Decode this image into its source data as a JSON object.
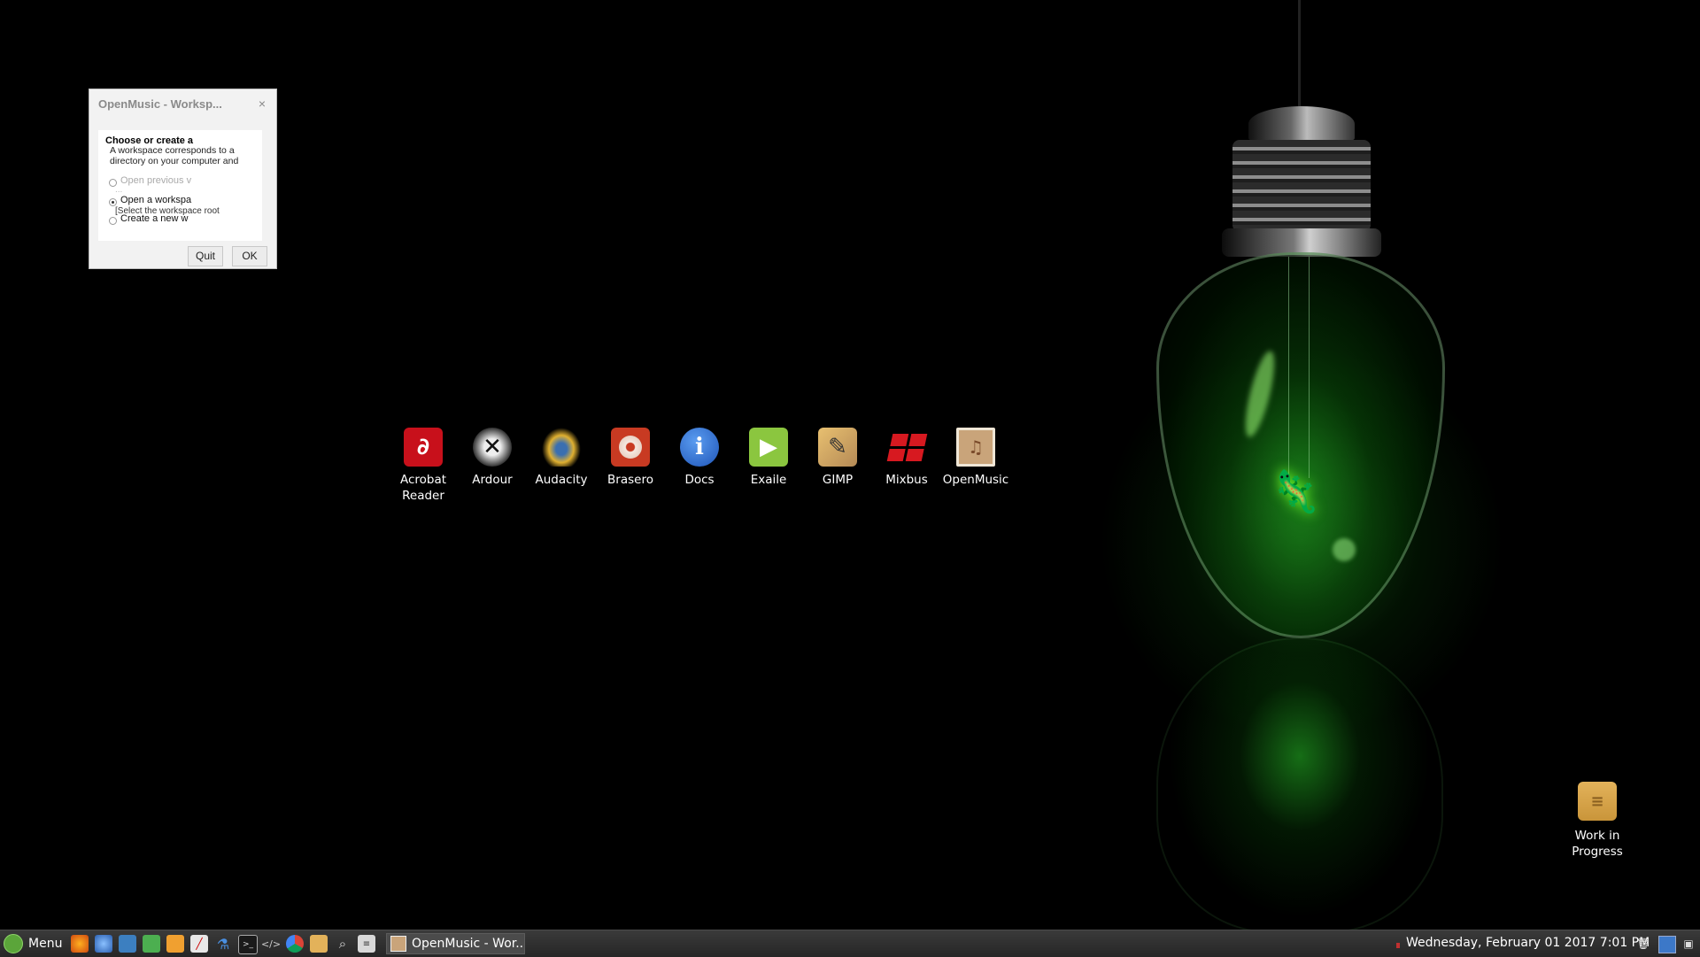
{
  "dialog": {
    "title": "OpenMusic - Worksp...",
    "close": "×",
    "heading": "Choose or create a",
    "description": "A workspace corresponds to a directory on your computer and",
    "option_previous": "Open previous v",
    "option_previous_sub": "...",
    "option_open": "Open a workspa",
    "option_open_sub": "[Select the workspace root",
    "option_create": "Create a new w",
    "quit_label": "Quit",
    "ok_label": "OK"
  },
  "desktop_icons": [
    {
      "name": "Acrobat Reader",
      "icon": "acrobat-icon",
      "color": "#c8101b"
    },
    {
      "name": "Ardour",
      "icon": "ardour-icon",
      "color": "#d0d0d0"
    },
    {
      "name": "Audacity",
      "icon": "audacity-icon",
      "color": "#e0a020"
    },
    {
      "name": "Brasero",
      "icon": "brasero-icon",
      "color": "#d0402a"
    },
    {
      "name": "Docs",
      "icon": "info-icon",
      "color": "#2a6fd6"
    },
    {
      "name": "Exaile",
      "icon": "play-icon",
      "color": "#8bc63f"
    },
    {
      "name": "GIMP",
      "icon": "gimp-icon",
      "color": "#b58a56"
    },
    {
      "name": "Mixbus",
      "icon": "mixbus-icon",
      "color": "#d71920"
    },
    {
      "name": "OpenMusic",
      "icon": "openmusic-icon",
      "color": "#c9a47a"
    }
  ],
  "folder": {
    "name": "Work in Progress",
    "icon": "folder-icon",
    "color": "#c9953a"
  },
  "taskbar": {
    "menu_label": "Menu",
    "launchers": [
      "firefox-icon",
      "thunderbird-icon",
      "files-icon",
      "spreadsheet-icon",
      "document-icon",
      "editor-icon",
      "flask-icon",
      "terminal-icon",
      "code-icon",
      "chrome-icon",
      "folder-edit-icon",
      "search-tool-icon",
      "calculator-icon"
    ],
    "task_label": "OpenMusic - Wor...",
    "clock": "Wednesday, February 01 2017  7:01 PM",
    "tray": [
      "trash-icon",
      "display-icon",
      "show-desktop-icon"
    ]
  }
}
